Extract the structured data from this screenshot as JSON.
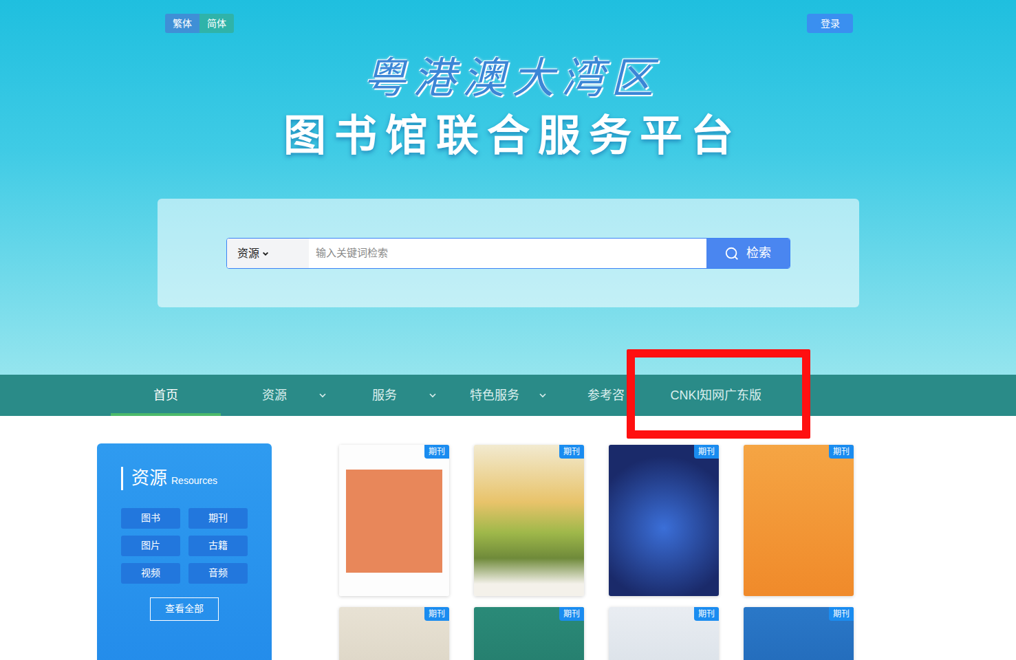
{
  "language": [
    {
      "label": "繁体",
      "selected": false
    },
    {
      "label": "简体",
      "selected": true
    }
  ],
  "login": "登录",
  "title": {
    "calligraphy": "粤港澳大湾区",
    "main": "图书馆联合服务平台"
  },
  "search": {
    "scope": "资源",
    "placeholder": "输入关键词检索",
    "button": "检索"
  },
  "nav": [
    {
      "label": "首页",
      "selected": true,
      "dropdown": false,
      "highlighted": false
    },
    {
      "label": "资源",
      "selected": false,
      "dropdown": true,
      "highlighted": false
    },
    {
      "label": "服务",
      "selected": false,
      "dropdown": true,
      "highlighted": false
    },
    {
      "label": "特色服务",
      "selected": false,
      "dropdown": true,
      "highlighted": false
    },
    {
      "label": "参考咨",
      "selected": false,
      "dropdown": false,
      "highlighted": false
    },
    {
      "label": "CNKI知网广东版",
      "selected": false,
      "dropdown": false,
      "highlighted": true
    }
  ],
  "sidebar": {
    "title": "资源",
    "subtitle": "Resources",
    "items": [
      "图书",
      "期刊",
      "图片",
      "古籍",
      "视频",
      "音频"
    ],
    "more": "查看全部"
  },
  "covers": [
    {
      "badge": "期刊"
    },
    {
      "badge": "期刊"
    },
    {
      "badge": "期刊"
    },
    {
      "badge": "期刊"
    },
    {
      "badge": "期刊"
    },
    {
      "badge": "期刊"
    },
    {
      "badge": "期刊"
    },
    {
      "badge": "期刊"
    }
  ]
}
